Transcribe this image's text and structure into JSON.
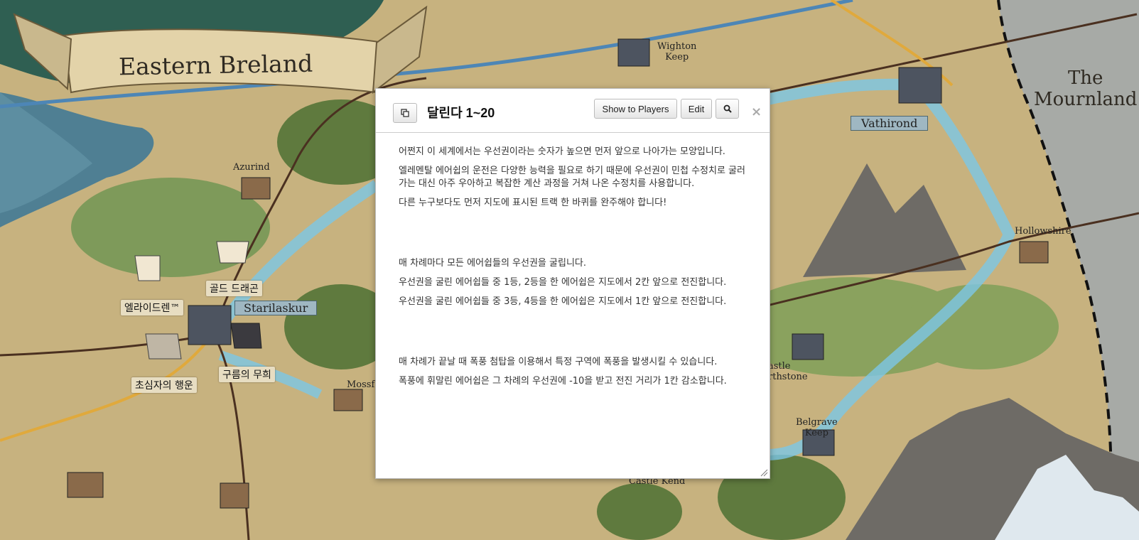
{
  "map": {
    "region_title": "Eastern Breland",
    "mournland_label": "The\nMournland",
    "places": {
      "wighton": "Wighton\nKeep",
      "azurind": "Azurind",
      "vathirond": "Vathirond",
      "hollowshire": "Hollowshire",
      "starilaskur": "Starilaskur",
      "mossfield": "Mossf",
      "castle_arthstone": "astle\nrthstone",
      "belgrave": "Belgrave\nKeep",
      "castle_kend": "Castle Kend"
    },
    "tokens": [
      {
        "label": "골드 드래곤"
      },
      {
        "label": "엘라이드렌™"
      },
      {
        "label": "구름의 무희"
      },
      {
        "label": "초심자의 행운"
      }
    ]
  },
  "dialog": {
    "title": "달린다 1~20",
    "buttons": {
      "show_to_players": "Show to Players",
      "edit": "Edit",
      "search_icon": "search-icon",
      "popout_icon": "popout-icon",
      "close": "×"
    },
    "paragraphs": {
      "p1": "어쩐지 이 세계에서는 우선권이라는 숫자가 높으면 먼저 앞으로 나아가는 모양입니다.",
      "p2": "엘레멘탈 에어쉽의 운전은 다양한 능력을 필요로 하기 때문에 우선권이 민첩 수정치로 굴러가는 대신 아주 우아하고 복잡한 계산 과정을 거쳐 나온 수정치를 사용합니다.",
      "p3": "다른 누구보다도 먼저 지도에 표시된 트랙 한 바퀴를 완주해야 합니다!",
      "p4": "매 차례마다 모든 에어쉽들의 우선권을 굴립니다.",
      "p5": "우선권을 굴린 에어쉽들 중 1등, 2등을 한 에어쉽은 지도에서 2칸 앞으로 전진합니다.",
      "p6": "우선권을 굴린 에어쉽들 중 3등, 4등을 한 에어쉽은 지도에서 1칸 앞으로 전진합니다.",
      "p7": "매 차례가 끝날 때 폭풍 첨탑을 이용해서 특정 구역에 폭풍을 발생시킬 수 있습니다.",
      "p8": "폭풍에 휘말린 에어쉽은 그 차례의 우선권에 -10을 받고 전진 거리가 1칸 감소합니다."
    }
  }
}
